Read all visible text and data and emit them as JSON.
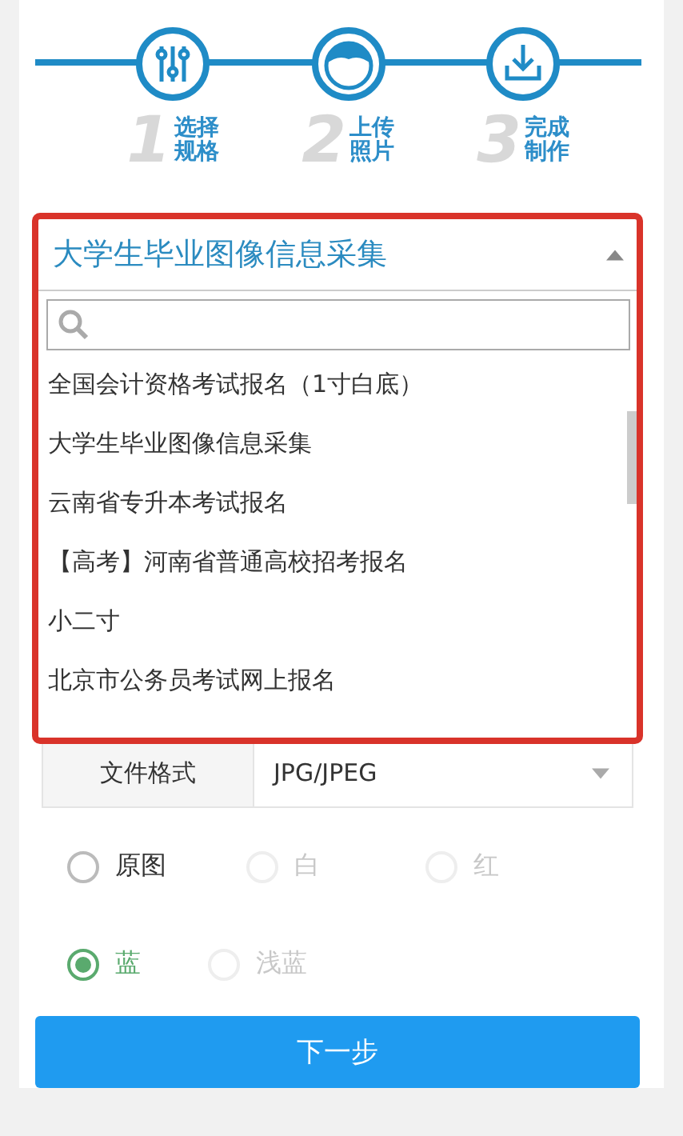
{
  "steps": [
    {
      "number": "1",
      "kind": "sliders",
      "lines": [
        "选择",
        "规格"
      ]
    },
    {
      "number": "2",
      "kind": "avatar",
      "lines": [
        "上传",
        "照片"
      ]
    },
    {
      "number": "3",
      "kind": "download",
      "lines": [
        "完成",
        "制作"
      ]
    }
  ],
  "spec_select": {
    "value": "大学生毕业图像信息采集",
    "expanded": true,
    "options": [
      "全国会计资格考试报名（1寸白底）",
      "大学生毕业图像信息采集",
      "云南省专升本考试报名",
      "【高考】河南省普通高校招考报名",
      "小二寸",
      "北京市公务员考试网上报名"
    ]
  },
  "file_format": {
    "label": "文件格式",
    "value": "JPG/JPEG"
  },
  "background_options": [
    {
      "label": "原图",
      "selected": false,
      "disabled": false
    },
    {
      "label": "白",
      "selected": false,
      "disabled": true
    },
    {
      "label": "红",
      "selected": false,
      "disabled": true
    },
    {
      "label": "蓝",
      "selected": true,
      "disabled": false
    },
    {
      "label": "浅蓝",
      "selected": false,
      "disabled": true
    }
  ],
  "next_button": "下一步"
}
